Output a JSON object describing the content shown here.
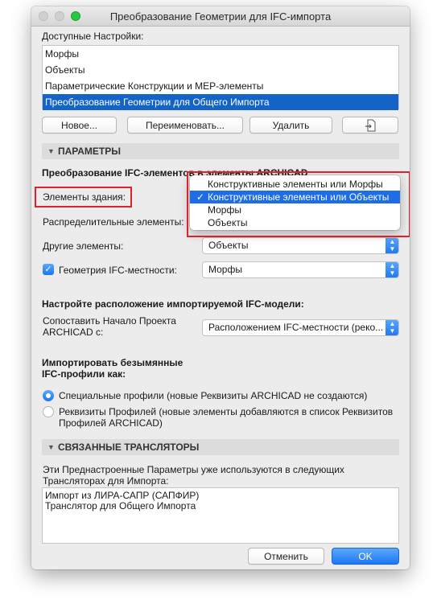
{
  "window": {
    "title": "Преобразование Геометрии для IFC-импорта"
  },
  "available": {
    "label": "Доступные Настройки:",
    "items": [
      "Морфы",
      "Объекты",
      "Параметрические Конструкции и МЕР-элементы",
      "Преобразование Геометрии для Общего Импорта"
    ],
    "selected_index": 3
  },
  "buttons": {
    "new": "Новое...",
    "rename": "Переименовать...",
    "delete": "Удалить",
    "import_icon": "import-file-icon",
    "cancel": "Отменить",
    "ok": "OK"
  },
  "params": {
    "section_title": "ПАРАМЕТРЫ",
    "heading": "Преобразование IFC-элементов в элементы ARCHICAD",
    "building_elements_label": "Элементы здания:",
    "distribution_label": "Распределительные элементы:",
    "other_label": "Другие элементы:",
    "other_value": "Объекты",
    "site_geometry_label": "Геометрия IFC-местности:",
    "site_geometry_checked": true,
    "site_geometry_value": "Морфы",
    "placement_heading": "Настройте расположение импортируемой IFC-модели:",
    "match_label_line1": "Сопоставить Начало Проекта",
    "match_label_line2": "ARCHICAD с:",
    "match_value": "Расположением IFC-местности (реко...",
    "unnamed_heading_line1": "Импортировать безымянные",
    "unnamed_heading_line2": "IFC-профили как:",
    "radio1": "Специальные профили (новые Реквизиты ARCHICAD не создаются)",
    "radio2_line1": "Реквизиты Профилей (новые элементы добавляются в список Реквизитов",
    "radio2_line2": "Профилей ARCHICAD)",
    "radio_selected": 1
  },
  "dropdown": {
    "options": [
      "Конструктивные элементы или Морфы",
      "Конструктивные элементы или Объекты",
      "Морфы",
      "Объекты"
    ],
    "selected_index": 1,
    "check": "✓"
  },
  "translators": {
    "section_title": "СВЯЗАННЫЕ ТРАНСЛЯТОРЫ",
    "desc_line1": "Эти Преднастроенные Параметры уже используются в следующих",
    "desc_line2": "Трансляторах для Импорта:",
    "items": [
      "Импорт из ЛИРА-САПР (САПФИР)",
      "Транслятор для Общего Импорта"
    ]
  },
  "colors": {
    "accent": "#1d6ee6",
    "highlight_box": "#e0202a",
    "selection": "#1463c6"
  }
}
